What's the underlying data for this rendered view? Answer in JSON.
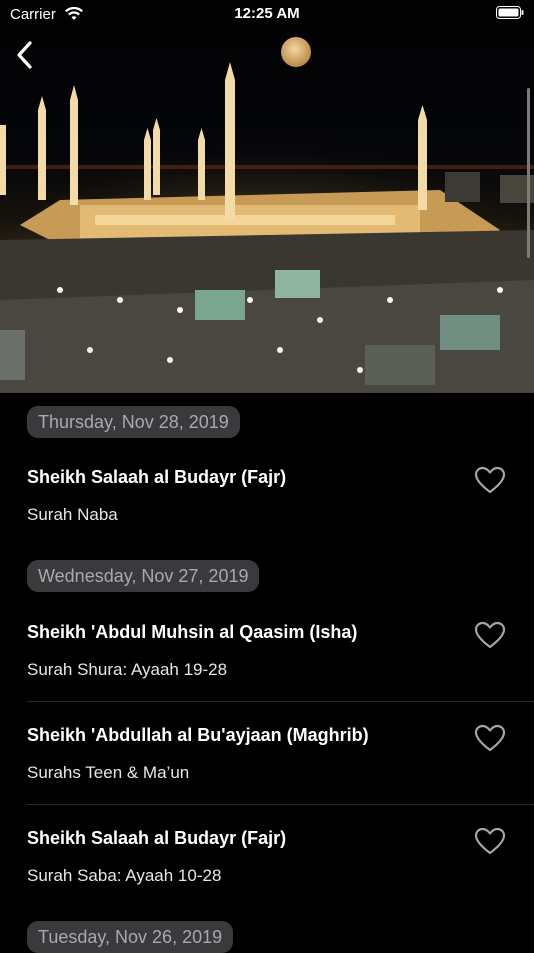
{
  "status_bar": {
    "carrier": "Carrier",
    "time": "12:25 AM"
  },
  "nav": {
    "back_icon": "chevron-left-icon"
  },
  "hero": {
    "description_icon": "mosque-night-photo"
  },
  "sections": [
    {
      "date": "Thursday, Nov 28, 2019",
      "items": [
        {
          "title": "Sheikh Salaah al Budayr (Fajr)",
          "subtitle": "Surah Naba"
        }
      ]
    },
    {
      "date": "Wednesday, Nov 27, 2019",
      "items": [
        {
          "title": "Sheikh 'Abdul Muhsin al Qaasim (Isha)",
          "subtitle": "Surah Shura: Ayaah 19-28"
        },
        {
          "title": "Sheikh 'Abdullah al Bu'ayjaan (Maghrib)",
          "subtitle": "Surahs Teen & Ma’un"
        },
        {
          "title": "Sheikh Salaah al Budayr (Fajr)",
          "subtitle": "Surah Saba: Ayaah 10-28"
        }
      ]
    },
    {
      "date": "Tuesday, Nov 26, 2019",
      "items": []
    }
  ],
  "colors": {
    "background": "#000000",
    "chip": "#3a3a3c",
    "chip_text": "#a9a9ad",
    "heart": "#a5a5a8"
  }
}
